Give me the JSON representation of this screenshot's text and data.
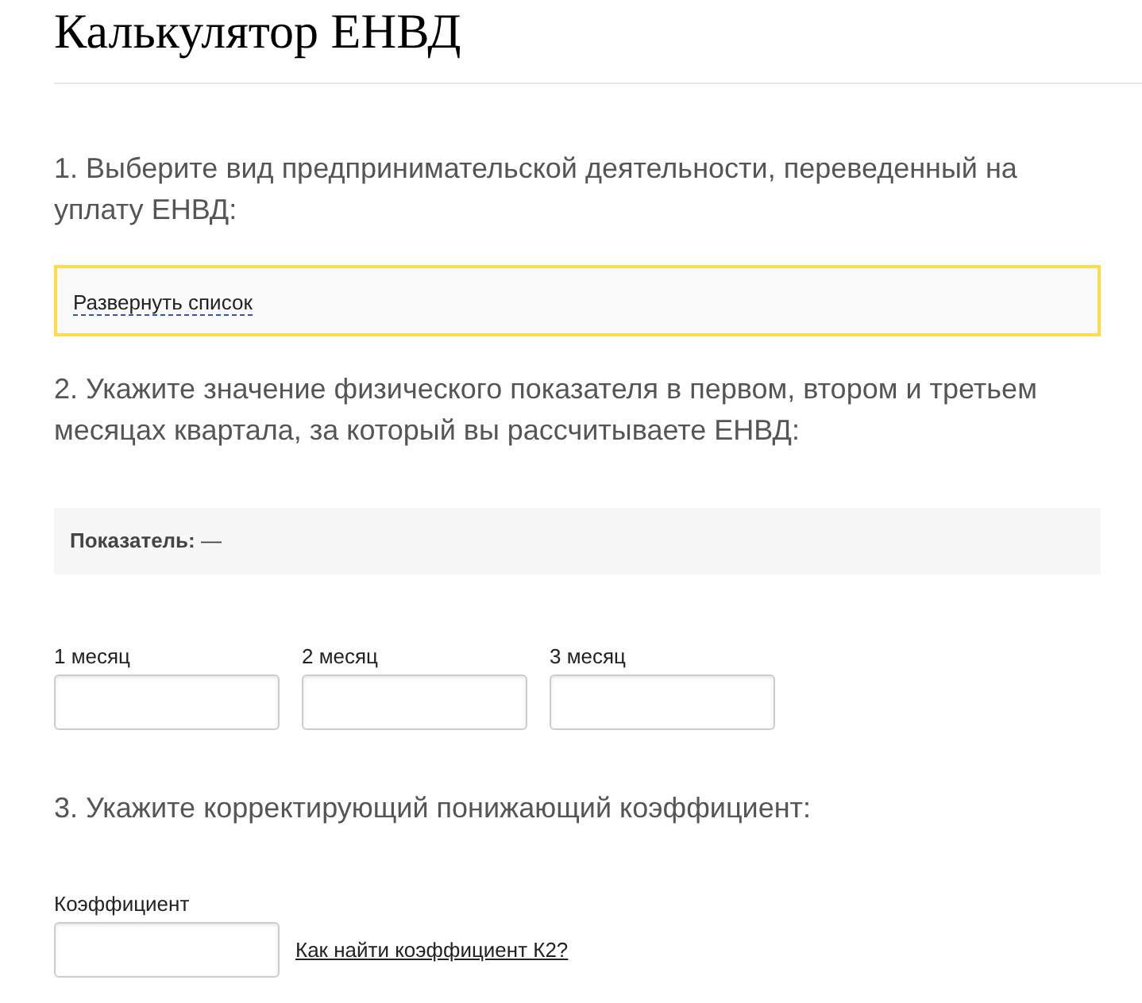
{
  "title": "Калькулятор ЕНВД",
  "steps": [
    {
      "kind": "dropdown",
      "question": "1. Выберите вид предпринимательской деятельности, переведенный на уплату ЕНВД:",
      "link": "Развернуть список"
    },
    {
      "kind": "months",
      "question": "2. Укажите значение физического показателя в первом, втором и третьем месяцах квартала, за который вы рассчитываете ЕНВД:",
      "indicator": "**Показатель:** —",
      "fields": [
        {
          "label": "1 месяц"
        },
        {
          "label": "2 месяц"
        },
        {
          "label": "3 месяц"
        }
      ]
    },
    {
      "kind": "coefficient",
      "question": "3. Укажите корректирующий понижающий коэффициент:",
      "fields": [
        {
          "label": "Коэффициент"
        }
      ],
      "link": "Как найти коэффициент К2?"
    }
  ]
}
